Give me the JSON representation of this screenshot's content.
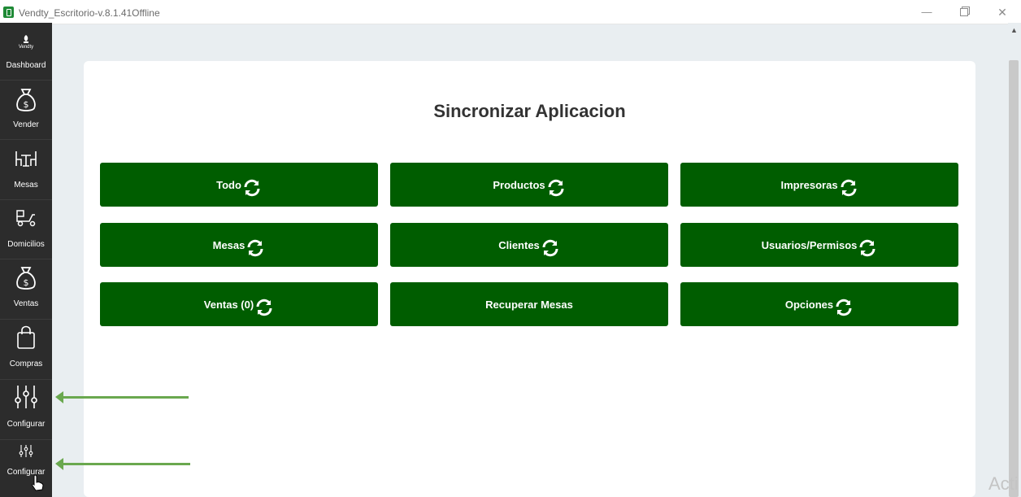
{
  "window": {
    "title": "Vendty_Escritorio-v.8.1.41Offline",
    "controls": {
      "minimize": "—",
      "maximize": "restore",
      "close": "✕"
    }
  },
  "sidebar": {
    "logo_text": "Vendty",
    "items": [
      {
        "label": "Dashboard",
        "icon": "dashboard-logo-icon"
      },
      {
        "label": "Vender",
        "icon": "money-bag-icon"
      },
      {
        "label": "Mesas",
        "icon": "tables-icon"
      },
      {
        "label": "Domicilios",
        "icon": "delivery-scooter-icon"
      },
      {
        "label": "Ventas",
        "icon": "money-bag-icon"
      },
      {
        "label": "Compras",
        "icon": "shopping-bag-icon"
      },
      {
        "label": "Configurar",
        "icon": "sliders-icon"
      },
      {
        "label": "Configurar",
        "icon": "sliders-icon"
      }
    ]
  },
  "main": {
    "title": "Sincronizar Aplicacion",
    "buttons": [
      {
        "label": "Todo",
        "icon": "sync-icon"
      },
      {
        "label": "Productos",
        "icon": "sync-icon"
      },
      {
        "label": "Impresoras",
        "icon": "sync-icon"
      },
      {
        "label": "Mesas",
        "icon": "sync-icon"
      },
      {
        "label": "Clientes",
        "icon": "sync-icon"
      },
      {
        "label": "Usuarios/Permisos",
        "icon": "sync-icon"
      },
      {
        "label": "Ventas (0)",
        "icon": "sync-icon"
      },
      {
        "label": "Recuperar Mesas",
        "icon": ""
      },
      {
        "label": "Opciones",
        "icon": "sync-icon"
      }
    ]
  },
  "overlay": {
    "watermark": "Acti"
  },
  "colors": {
    "sidebar": "#2c2c2c",
    "button": "#005d00",
    "background": "#e9eef1",
    "arrow": "#6aa84f"
  }
}
